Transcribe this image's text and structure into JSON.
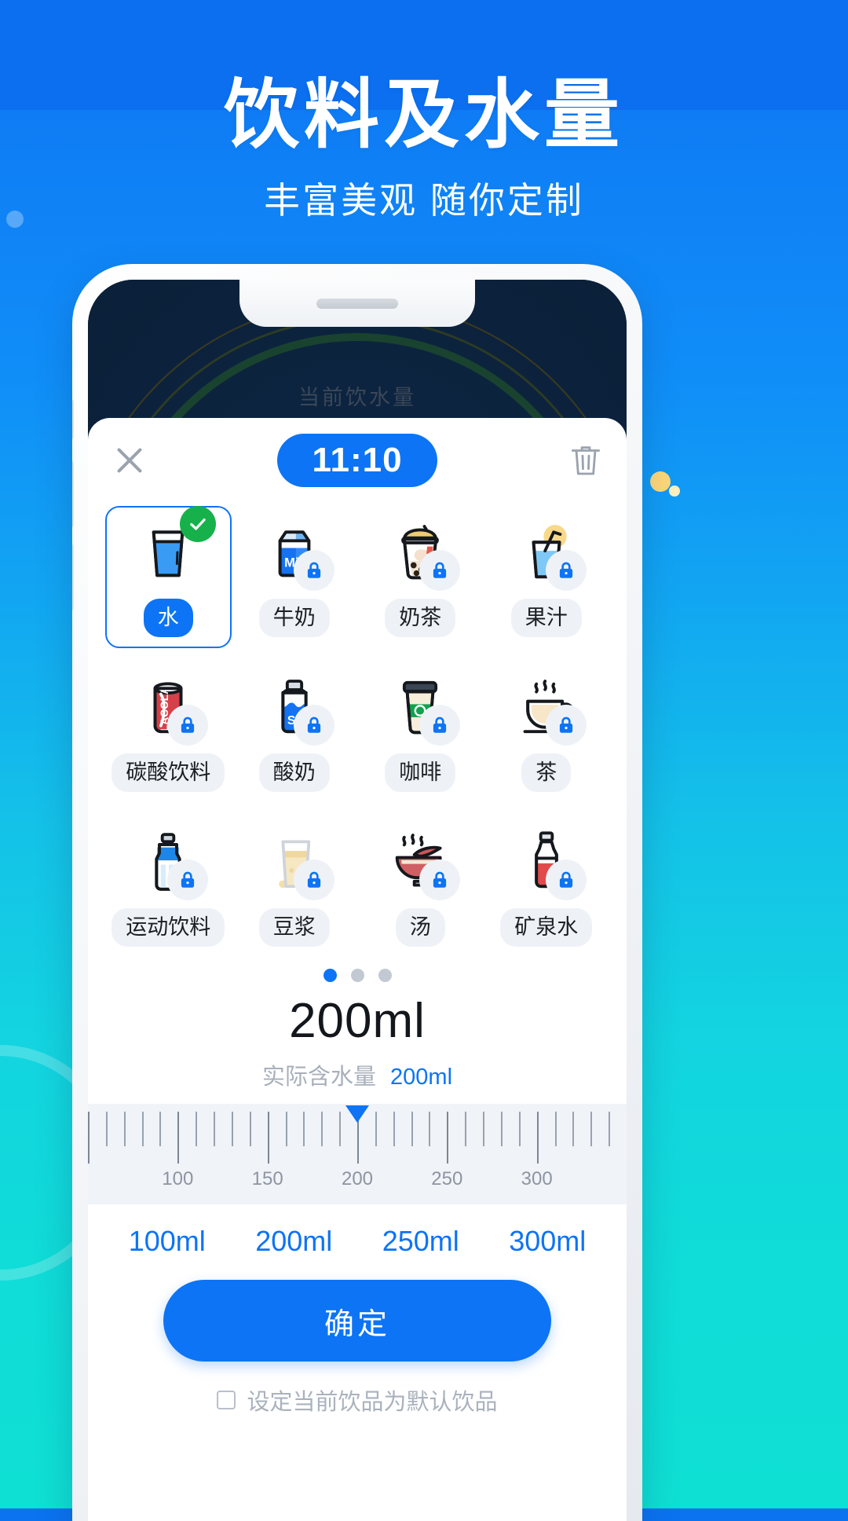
{
  "promo": {
    "title": "饮料及水量",
    "subtitle": "丰富美观 随你定制"
  },
  "app": {
    "background_title": "当前饮水量"
  },
  "sheet": {
    "close_icon": "close-icon",
    "time": "11:10",
    "delete_icon": "trash-icon",
    "drinks": [
      {
        "label": "水",
        "icon": "water-glass-icon",
        "locked": false,
        "selected": true
      },
      {
        "label": "牛奶",
        "icon": "milk-carton-icon",
        "locked": true,
        "selected": false
      },
      {
        "label": "奶茶",
        "icon": "bubble-tea-icon",
        "locked": true,
        "selected": false
      },
      {
        "label": "果汁",
        "icon": "juice-glass-icon",
        "locked": true,
        "selected": false
      },
      {
        "label": "碳酸饮料",
        "icon": "soda-can-icon",
        "locked": true,
        "selected": false
      },
      {
        "label": "酸奶",
        "icon": "yogurt-carton-icon",
        "locked": true,
        "selected": false
      },
      {
        "label": "咖啡",
        "icon": "coffee-cup-icon",
        "locked": true,
        "selected": false
      },
      {
        "label": "茶",
        "icon": "tea-cup-icon",
        "locked": true,
        "selected": false
      },
      {
        "label": "运动饮料",
        "icon": "sports-bottle-icon",
        "locked": true,
        "selected": false
      },
      {
        "label": "豆浆",
        "icon": "soymilk-glass-icon",
        "locked": true,
        "selected": false
      },
      {
        "label": "汤",
        "icon": "soup-bowl-icon",
        "locked": true,
        "selected": false
      },
      {
        "label": "矿泉水",
        "icon": "mineral-bottle-icon",
        "locked": true,
        "selected": false
      }
    ],
    "pagination": {
      "total": 3,
      "active": 1
    },
    "amount": {
      "value": "200ml",
      "actual_label": "实际含水量",
      "actual_value": "200ml"
    },
    "ruler": {
      "labels": [
        "100",
        "150",
        "200",
        "250",
        "300"
      ],
      "current": "200"
    },
    "quick_amounts": [
      "100ml",
      "200ml",
      "250ml",
      "300ml"
    ],
    "confirm_label": "确定",
    "default_drink_label": "设定当前饮品为默认饮品"
  },
  "colors": {
    "accent": "#0d74f5",
    "check_green": "#17b14b",
    "chip_bg": "#eef2f7",
    "muted_text": "#a8b0bb"
  }
}
